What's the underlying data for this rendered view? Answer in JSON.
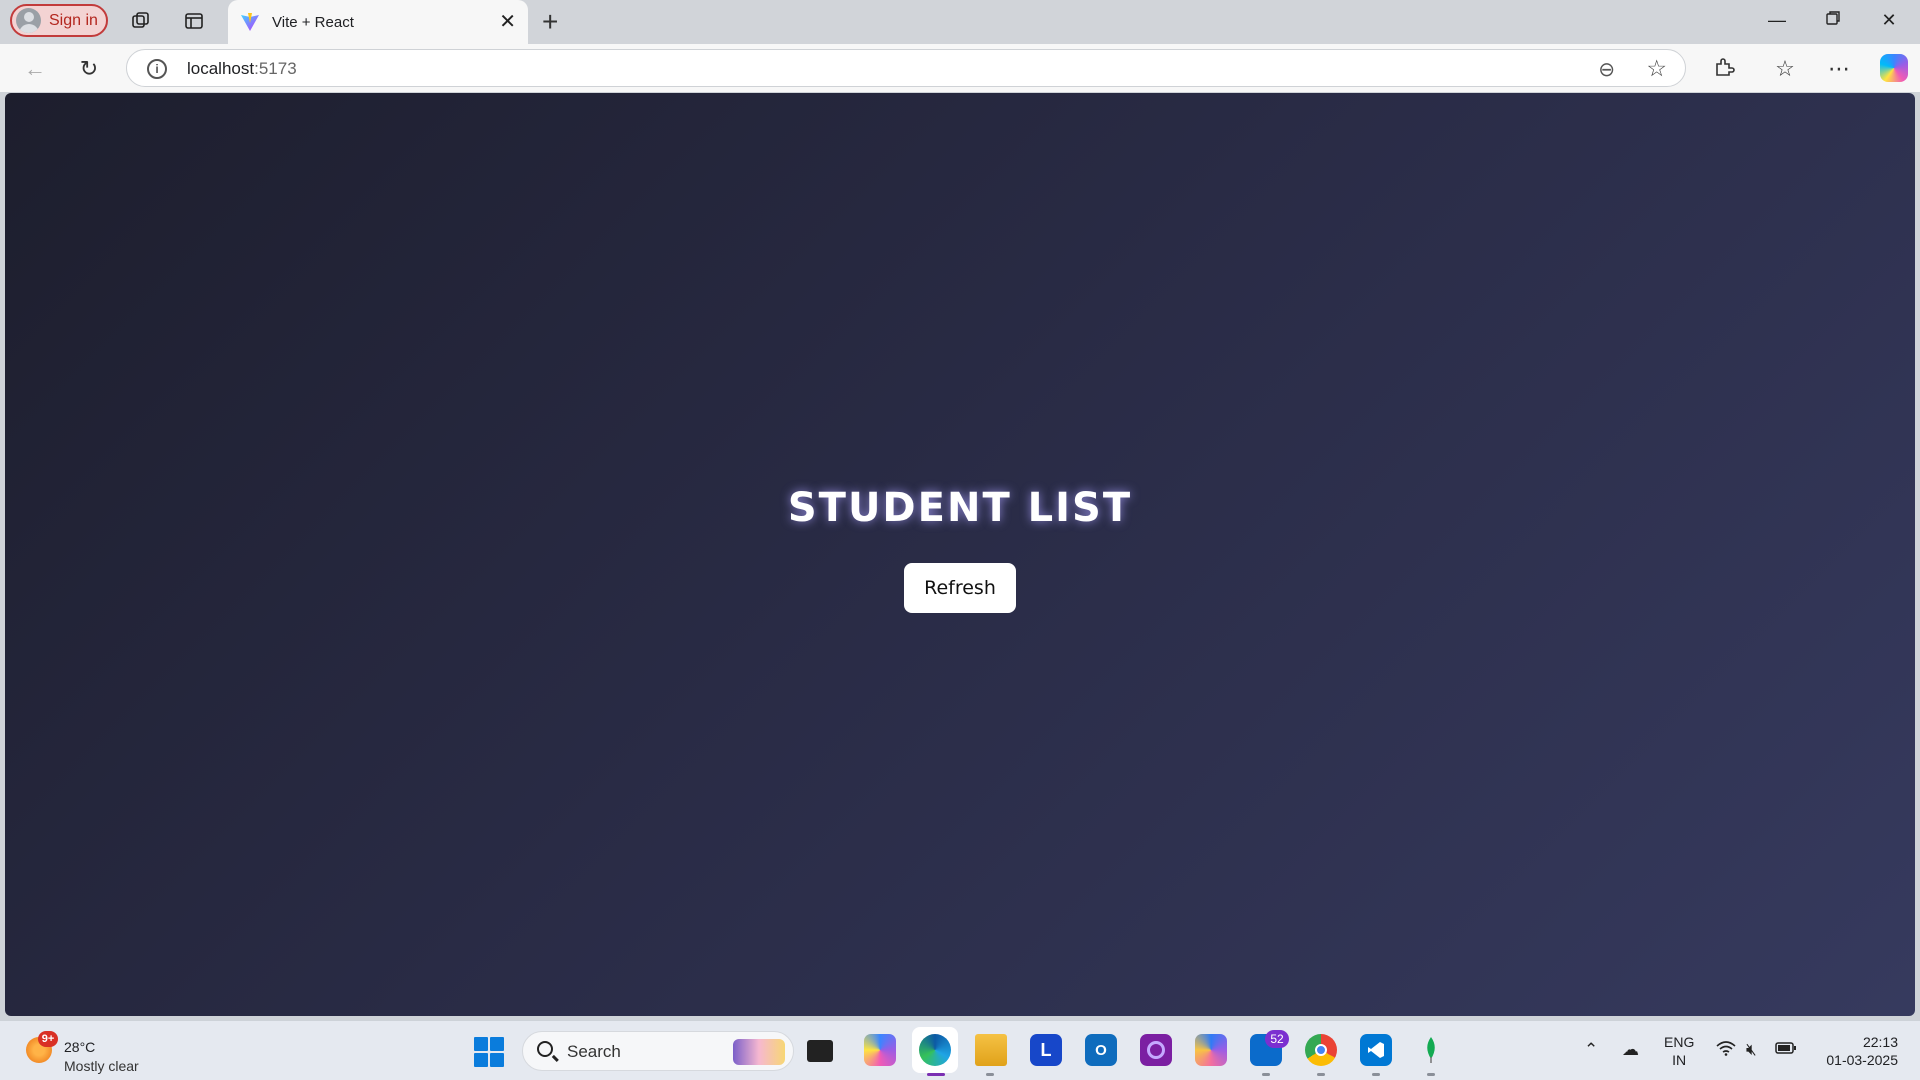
{
  "browser": {
    "signin_label": "Sign in",
    "tab_title": "Vite + React",
    "url_host": "localhost",
    "url_port": ":5173"
  },
  "page": {
    "heading": "STUDENT LIST",
    "refresh_label": "Refresh"
  },
  "taskbar": {
    "weather_badge": "9+",
    "temperature": "28°C",
    "condition": "Mostly clear",
    "search_placeholder": "Search",
    "app_badge": "52",
    "lang_top": "ENG",
    "lang_bottom": "IN",
    "time": "22:13",
    "date": "01-03-2025",
    "apps": [
      "file-explorer-icon",
      "copilot-icon",
      "edge-icon",
      "folder-icon",
      "l-app-icon",
      "outlook-icon",
      "cortana-icon",
      "m365-icon",
      "store-icon",
      "chrome-icon",
      "vscode-icon",
      "mongodb-icon"
    ]
  }
}
